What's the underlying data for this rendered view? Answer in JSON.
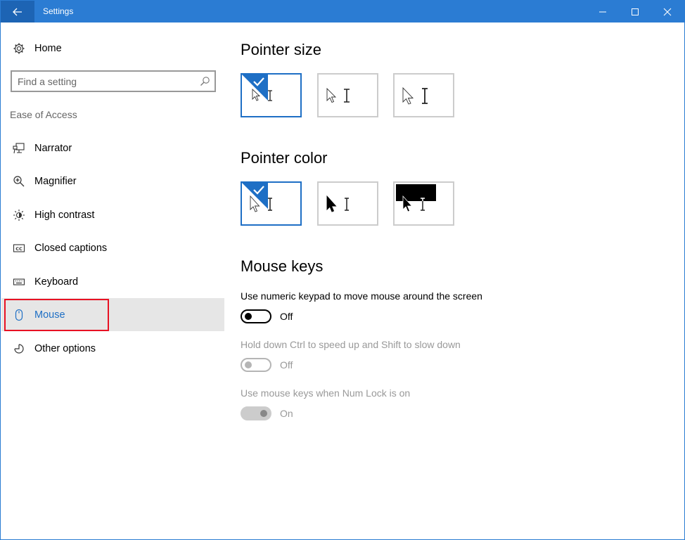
{
  "titlebar": {
    "title": "Settings"
  },
  "sidebar": {
    "home_label": "Home",
    "search_placeholder": "Find a setting",
    "section_label": "Ease of Access",
    "items": [
      {
        "label": "Narrator",
        "icon": "narrator-icon"
      },
      {
        "label": "Magnifier",
        "icon": "magnifier-icon"
      },
      {
        "label": "High contrast",
        "icon": "high-contrast-icon"
      },
      {
        "label": "Closed captions",
        "icon": "closed-captions-icon"
      },
      {
        "label": "Keyboard",
        "icon": "keyboard-icon"
      },
      {
        "label": "Mouse",
        "icon": "mouse-icon",
        "active": true
      },
      {
        "label": "Other options",
        "icon": "other-options-icon"
      }
    ]
  },
  "main": {
    "pointer_size": {
      "heading": "Pointer size",
      "selected_index": 0
    },
    "pointer_color": {
      "heading": "Pointer color",
      "selected_index": 0
    },
    "mouse_keys": {
      "heading": "Mouse keys",
      "settings": [
        {
          "description": "Use numeric keypad to move mouse around the screen",
          "state": "Off",
          "enabled": true
        },
        {
          "description": "Hold down Ctrl to speed up and Shift to slow down",
          "state": "Off",
          "enabled": false
        },
        {
          "description": "Use mouse keys when Num Lock is on",
          "state": "On",
          "enabled": false
        }
      ]
    }
  },
  "colors": {
    "accent": "#2b7cd3",
    "accent_dark": "#1d64b4",
    "active_text": "#1e6fc5",
    "highlight": "#e81123"
  }
}
